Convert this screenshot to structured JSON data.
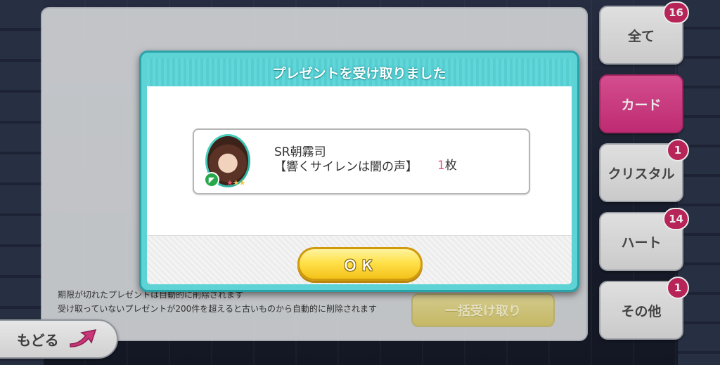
{
  "dialog": {
    "title": "プレゼントを受け取りました",
    "item": {
      "name_line1": "SR朝霧司",
      "name_line2": "【響くサイレンは闇の声】",
      "quantity": "1",
      "unit": "枚"
    },
    "ok_label": "ＯＫ"
  },
  "notice": {
    "line1": "期限が切れたプレゼントは自動的に削除されます",
    "line2": "受け取っていないプレゼントが200件を超えると古いものから自動的に削除されます"
  },
  "bulk_receive_label": "一括受け取り",
  "back_label": "もどる",
  "tabs": [
    {
      "label": "全て",
      "badge": "16"
    },
    {
      "label": "カード",
      "badge": ""
    },
    {
      "label": "クリスタル",
      "badge": "1"
    },
    {
      "label": "ハート",
      "badge": "14"
    },
    {
      "label": "その他",
      "badge": "1"
    }
  ],
  "colors": {
    "active_tab": "#cf2f7c",
    "badge": "#c7285f",
    "dialog_frame": "#5ed3d6",
    "ok_button": "#ffe14a"
  }
}
